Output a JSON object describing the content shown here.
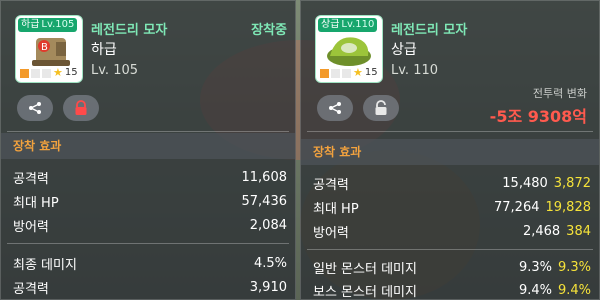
{
  "colors": {
    "grade_low": "#17a66d",
    "name_green": "#7fe8b6",
    "section_orange": "#f2a23e",
    "bonus_yellow": "#f5e23a",
    "power_down_red": "#ff5a4e"
  },
  "left_item": {
    "badge_grade": "하급",
    "badge_level": "Lv.105",
    "star_count": "15",
    "name": "레전드리 모자",
    "grade": "하급",
    "level": "Lv. 105",
    "status": "장착중",
    "share_icon": "share-icon",
    "lock_icon": "lock-icon",
    "section_title": "장착 효과",
    "stats": [
      {
        "label": "공격력",
        "value": "11,608"
      },
      {
        "label": "최대 HP",
        "value": "57,436"
      },
      {
        "label": "방어력",
        "value": "2,084"
      }
    ],
    "extra_stats": [
      {
        "label": "최종 데미지",
        "value": "4.5%"
      },
      {
        "label": "공격력",
        "value": "3,910"
      }
    ]
  },
  "right_item": {
    "badge_grade": "상급",
    "badge_level": "Lv.110",
    "star_count": "15",
    "name": "레전드리 모자",
    "grade": "상급",
    "level": "Lv. 110",
    "share_icon": "share-icon",
    "unlock_icon": "unlock-icon",
    "power_label": "전투력 변화",
    "power_change": "-5조 9308억",
    "section_title": "장착 효과",
    "stats": [
      {
        "label": "공격력",
        "value": "15,480",
        "bonus": "3,872"
      },
      {
        "label": "최대 HP",
        "value": "77,264",
        "bonus": "19,828"
      },
      {
        "label": "방어력",
        "value": "2,468",
        "bonus": "384"
      }
    ],
    "extra_stats": [
      {
        "label": "일반 몬스터 데미지",
        "value": "9.3%",
        "bonus": "9.3%"
      },
      {
        "label": "보스 몬스터 데미지",
        "value": "9.4%",
        "bonus": "9.4%"
      }
    ]
  }
}
